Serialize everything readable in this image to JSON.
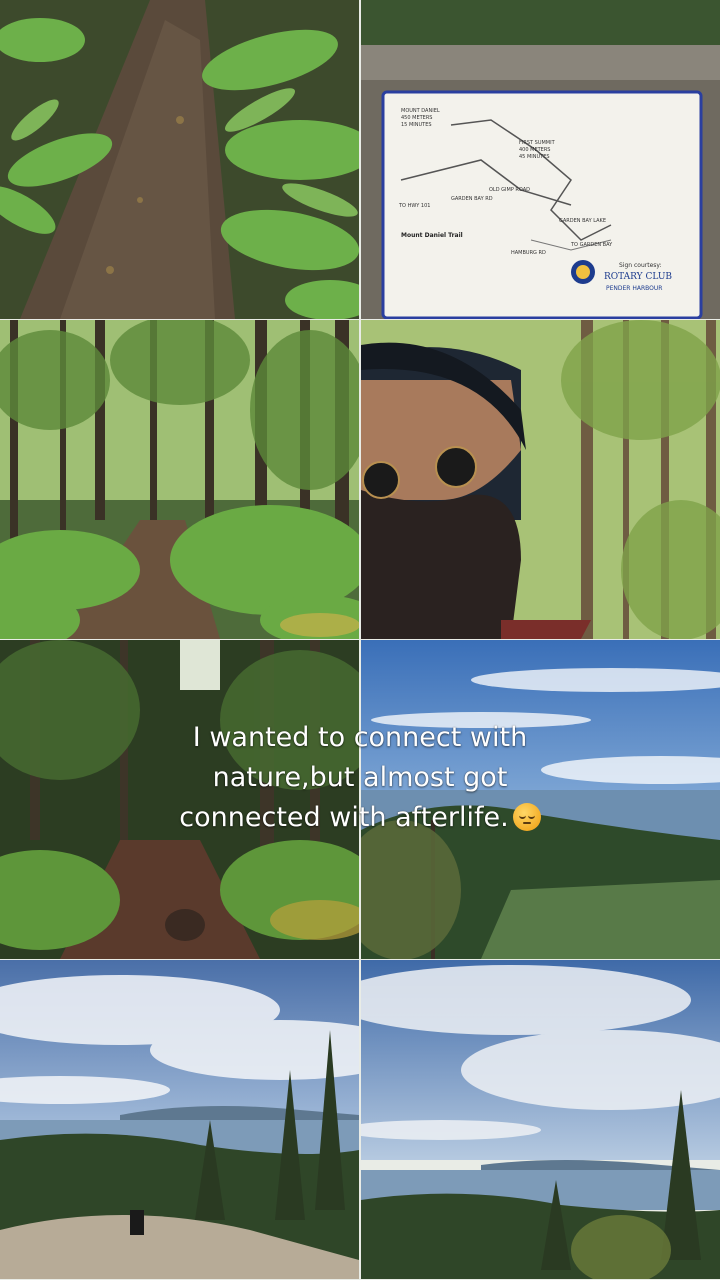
{
  "caption": {
    "line1": "I wanted to connect with",
    "line2": "nature,but almost got",
    "line3": "connected with afterlife.",
    "emoji": "pensive-face-emoji"
  },
  "sign": {
    "title": "Mount Daniel Trail",
    "labels": {
      "mount_daniel": "MOUNT DANIEL",
      "meters": "450 METERS",
      "minutes": "15 MINUTES",
      "first_summit": "FIRST SUMMIT",
      "first_summit_meters": "400 METERS",
      "minutes_45": "45 MINUTES",
      "old_gimp_road": "OLD GIMP ROAD",
      "to_hwy_101": "TO HWY 101",
      "garden_bay_rd": "GARDEN BAY RD",
      "garden_bay_lake": "GARDEN BAY LAKE",
      "to_garden_bay": "TO GARDEN BAY",
      "hamburg_rd": "HAMBURG RD"
    },
    "courtesy": "Sign courtesy:",
    "club": "ROTARY CLUB",
    "club_place": "PENDER HARBOUR"
  },
  "colors": {
    "caption_text": "#ffffff",
    "forest_dark": "#22331a",
    "fern_green": "#5f9a3a",
    "sky_blue": "#4f7fc0"
  }
}
